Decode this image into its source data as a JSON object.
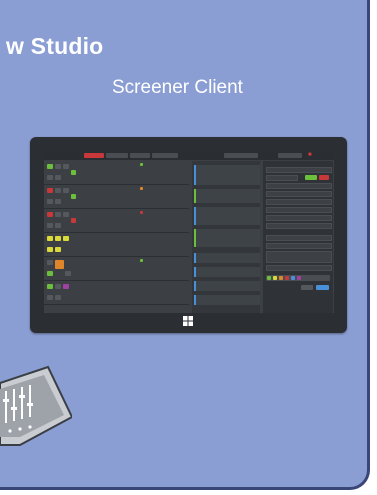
{
  "hero": {
    "title": "w Studio",
    "subtitle": "Screener Client"
  },
  "colors": {
    "panel": "#8b9ed4",
    "screen_bg": "#3c4045",
    "accent_red": "#d83a3a",
    "accent_green": "#6bbf3a",
    "accent_yellow": "#d9d93a",
    "accent_orange": "#e0862a",
    "accent_blue": "#4a90d9"
  },
  "icons": {
    "windows": "windows-logo-icon",
    "console": "mixing-console-icon"
  }
}
